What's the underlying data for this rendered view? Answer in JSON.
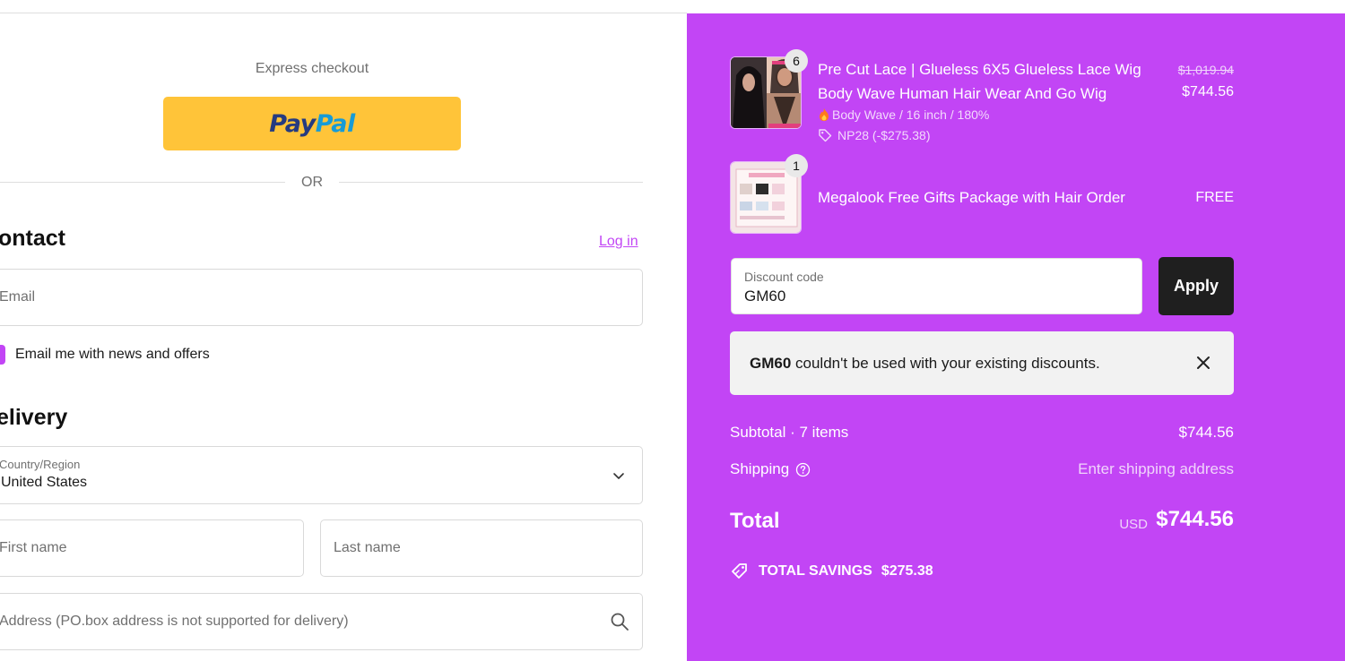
{
  "express": {
    "label": "Express checkout",
    "paypal_part1": "Pay",
    "paypal_part2": "Pal",
    "or": "OR"
  },
  "contact": {
    "title": "ontact",
    "login": "Log in",
    "email_placeholder": "Email",
    "newsletter_label": "Email me with news and offers"
  },
  "delivery": {
    "title": "elivery",
    "country_label": "Country/Region",
    "country_value": "United States",
    "first_name_placeholder": "First name",
    "last_name_placeholder": "Last name",
    "address_placeholder": "Address (PO.box address is not supported for delivery)"
  },
  "order": {
    "items": [
      {
        "qty": "6",
        "title_line1": "Pre Cut Lace | Glueless 6X5 Glueless Lace Wig",
        "title_line2": "Body Wave Human Hair Wear And Go Wig",
        "variant": "Body Wave / 16 inch / 180%",
        "discount": "NP28 (-$275.38)",
        "original_price": "$1,019.94",
        "price": "$744.56"
      },
      {
        "qty": "1",
        "title_line1": "Megalook Free Gifts Package with Hair Order",
        "price": "FREE"
      }
    ],
    "discount_code": {
      "label": "Discount code",
      "value": "GM60",
      "apply": "Apply"
    },
    "notice": {
      "code": "GM60",
      "message": " couldn't be used with your existing discounts."
    },
    "subtotal_label": "Subtotal · 7 items",
    "subtotal_value": "$744.56",
    "shipping_label": "Shipping",
    "shipping_value": "Enter shipping address",
    "total_label": "Total",
    "total_currency": "USD",
    "total_value": "$744.56",
    "savings_label": "TOTAL SAVINGS",
    "savings_value": "$275.38"
  },
  "colors": {
    "accent": "#c245f5",
    "paypal_yellow": "#ffc439",
    "apply_bg": "#1f1f1f"
  }
}
